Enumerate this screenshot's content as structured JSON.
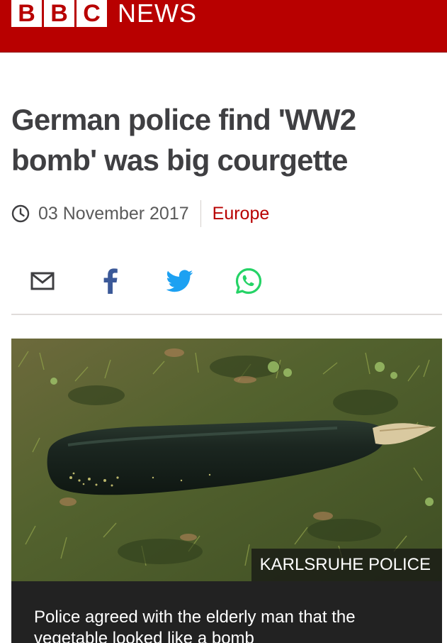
{
  "masthead": {
    "brand_letters": [
      "B",
      "B",
      "C"
    ],
    "brand_word": "NEWS",
    "brand_color": "#b80000"
  },
  "article": {
    "headline": "German police find 'WW2 bomb' was big courgette",
    "date": "03 November 2017",
    "section": "Europe",
    "meta_icon": "clock-icon"
  },
  "share": {
    "buttons": [
      {
        "name": "email",
        "icon": "envelope-icon",
        "color": "#3f3f42"
      },
      {
        "name": "facebook",
        "icon": "facebook-icon",
        "color": "#3b5998"
      },
      {
        "name": "twitter",
        "icon": "twitter-icon",
        "color": "#1da1f2"
      },
      {
        "name": "whatsapp",
        "icon": "whatsapp-icon",
        "color": "#25d366"
      }
    ]
  },
  "media": {
    "image_subject": "large courgette lying on grass",
    "credit": "KARLSRUHE POLICE",
    "caption": "Police agreed with the elderly man that the vegetable looked like a bomb"
  }
}
